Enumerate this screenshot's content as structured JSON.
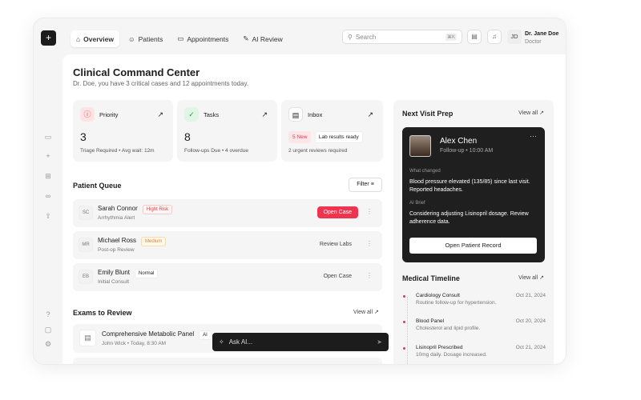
{
  "nav": {
    "tabs": [
      {
        "label": "Overview",
        "icon": "home-icon"
      },
      {
        "label": "Patients",
        "icon": "user-icon"
      },
      {
        "label": "Appointments",
        "icon": "calendar-icon"
      },
      {
        "label": "AI Review",
        "icon": "sparkle-icon"
      }
    ]
  },
  "search": {
    "placeholder": "Search",
    "shortcut": "⌘K"
  },
  "user": {
    "initials": "JD",
    "name": "Dr. Jane Doe",
    "role": "Doctor"
  },
  "header": {
    "title": "Clinical Command Center",
    "subtitle": "Dr. Doe, you have 3 critical cases and 12 appointments today."
  },
  "cards": [
    {
      "title": "Priority",
      "value": "3",
      "footer": "Triage Required • Avg wait: 12m"
    },
    {
      "title": "Tasks",
      "value": "8",
      "footer": "Follow-ups Due • 4 overdue"
    },
    {
      "title": "Inbox",
      "tag_new": "5 New",
      "tag_lab": "Lab results ready",
      "footer": "2 urgent reviews required"
    }
  ],
  "queue": {
    "title": "Patient Queue",
    "filter": "Filter",
    "rows": [
      {
        "initials": "SC",
        "name": "Sarah Connor",
        "badge": "Hight Risk",
        "detail": "Arrhythmia Alert",
        "action": "Open Case"
      },
      {
        "initials": "MR",
        "name": "Michael Ross",
        "badge": "Medium",
        "detail": "Post-op Review",
        "action": "Review Labs"
      },
      {
        "initials": "EB",
        "name": "Emily Blunt",
        "badge": "Normal",
        "detail": "Initial Consult",
        "action": "Open Case"
      }
    ]
  },
  "exams": {
    "title": "Exams to Review",
    "view_all": "View all",
    "items": [
      {
        "name": "Comprehensive Metabolic Panel",
        "detail": "John Wick • Today, 8:30 AM",
        "tag": "AI"
      }
    ]
  },
  "ask": {
    "placeholder": "Ask AI..."
  },
  "visit": {
    "title": "Next Visit Prep",
    "view_all": "View all",
    "name": "Alex Chen",
    "time": "Follow-up • 10:00 AM",
    "changed_label": "What changed",
    "changed": "Blood pressure elevated (135/85) since last visit. Reported headaches.",
    "brief_label": "AI Brief",
    "brief": "Considering adjusting Lisinopril dosage. Review adherence data.",
    "button": "Open Patient Record"
  },
  "timeline": {
    "title": "Medical Timeline",
    "view_all": "View all",
    "items": [
      {
        "title": "Cardiology Consult",
        "desc": "Routine follow-up for hypertension.",
        "date": "Oct 21, 2024"
      },
      {
        "title": "Blood Panel",
        "desc": "Cholesterol and lipid profile.",
        "date": "Oct 20, 2024"
      },
      {
        "title": "Lisinopril Prescribed",
        "desc": "10mg daily. Dosage increased.",
        "date": "Oct 21, 2024"
      }
    ]
  }
}
